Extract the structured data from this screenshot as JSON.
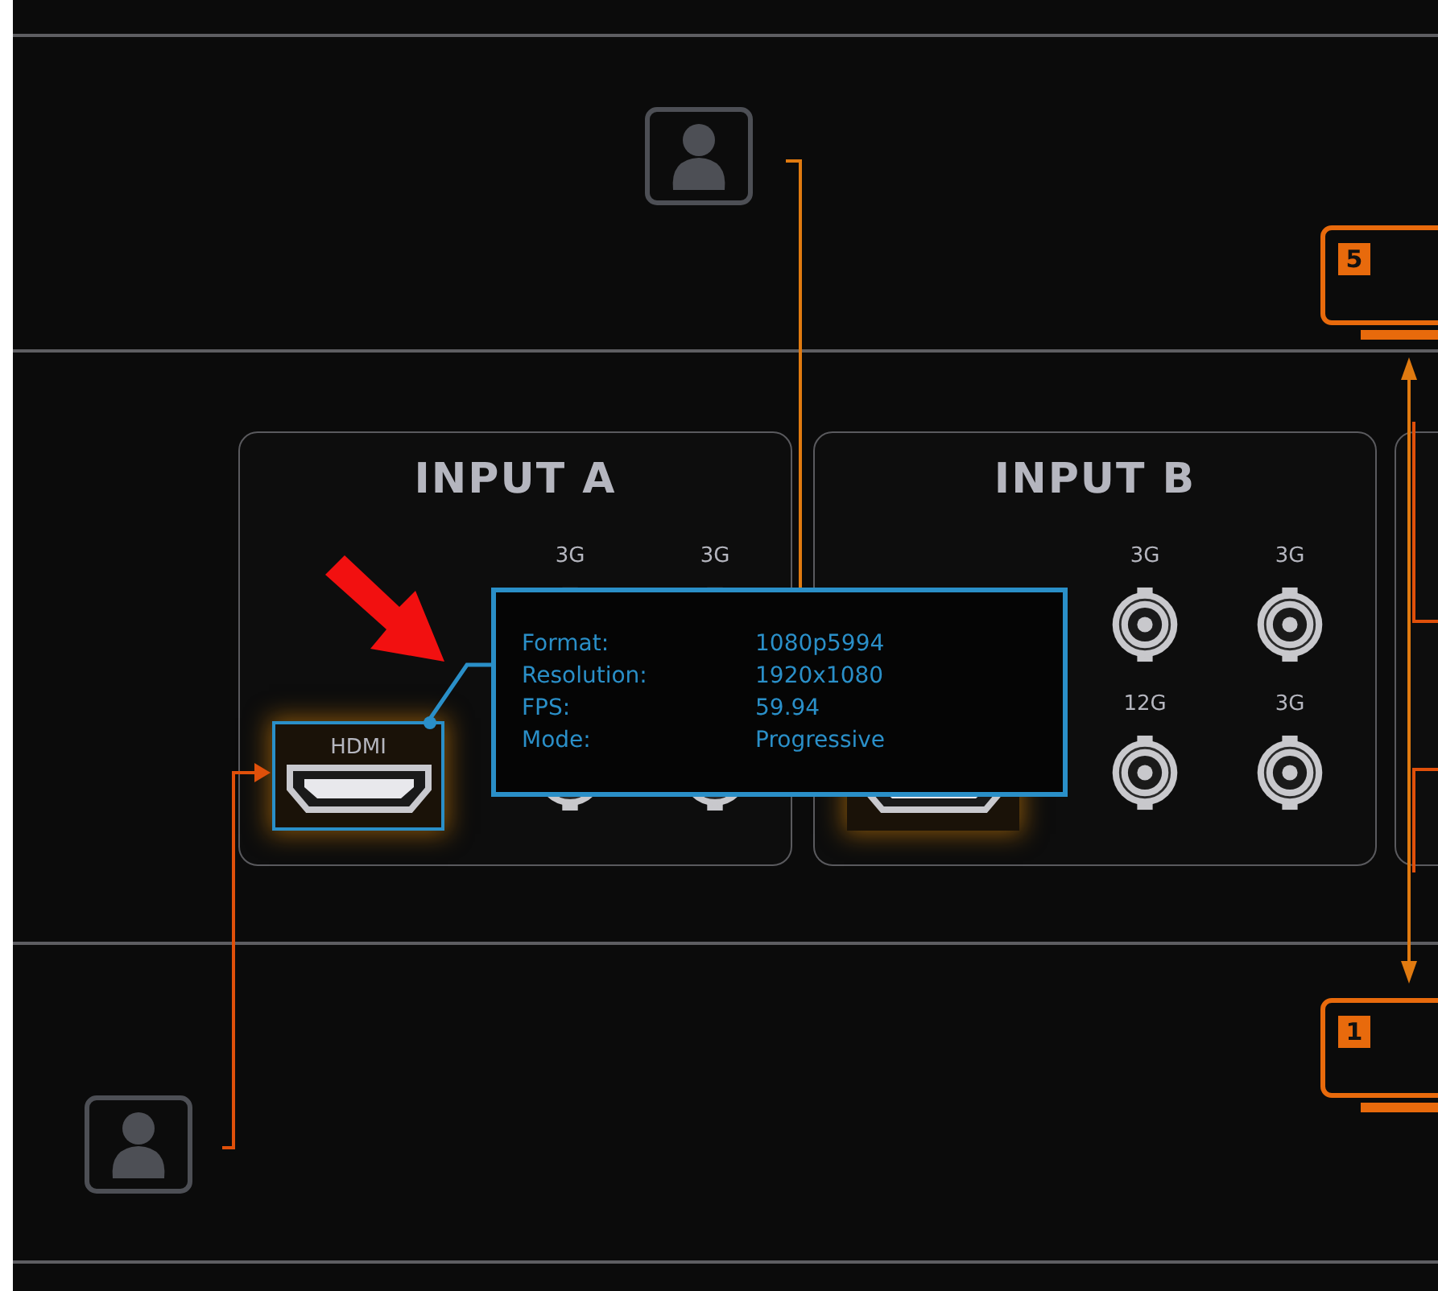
{
  "inputs": [
    {
      "title": "INPUT A",
      "hdmi": {
        "label": "HDMI",
        "selected": true
      },
      "ports": [
        {
          "label": "3G"
        },
        {
          "label": "3G"
        }
      ]
    },
    {
      "title": "INPUT B",
      "hdmi": {
        "selected": false
      },
      "ports": [
        {
          "label": "3G"
        },
        {
          "label": "3G"
        },
        {
          "label": "12G"
        },
        {
          "label": "3G"
        }
      ]
    }
  ],
  "tooltip": {
    "rows": [
      {
        "label": "Format:",
        "value": "1080p5994"
      },
      {
        "label": "Resolution:",
        "value": "1920x1080"
      },
      {
        "label": "FPS:",
        "value": "59.94"
      },
      {
        "label": "Mode:",
        "value": "Progressive"
      }
    ]
  },
  "monitors": [
    {
      "number": "5"
    },
    {
      "number": "1"
    }
  ]
}
